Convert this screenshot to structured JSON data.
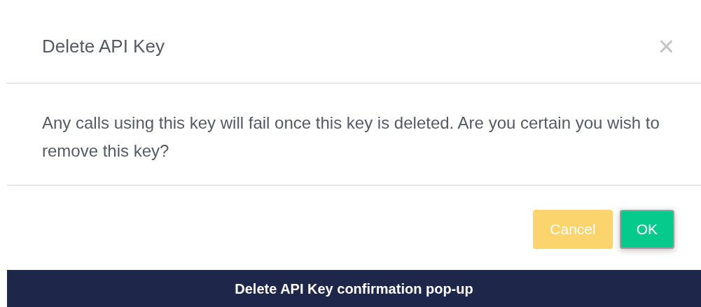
{
  "dialog": {
    "title": "Delete API Key",
    "close": "×",
    "message": "Any calls using this key will fail once this key is deleted. Are you certain you wish to remove this key?",
    "buttons": [
      {
        "label": "Cancel",
        "kind": "cancel",
        "focused": false
      },
      {
        "label": "OK",
        "kind": "confirm",
        "focused": true
      }
    ]
  },
  "caption": "Delete API Key confirmation pop-up"
}
